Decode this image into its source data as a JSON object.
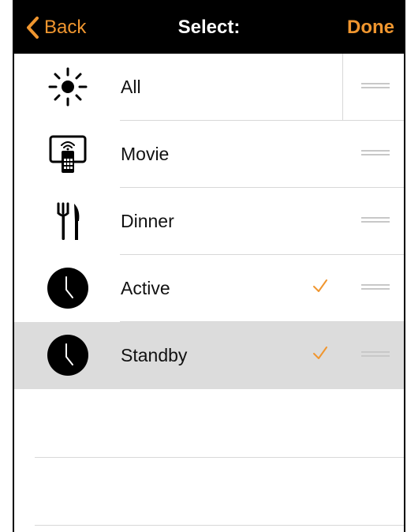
{
  "navbar": {
    "back_label": "Back",
    "title": "Select:",
    "done_label": "Done",
    "accent_color": "#f0962f"
  },
  "items": [
    {
      "label": "All",
      "icon": "sun-icon",
      "checked": false
    },
    {
      "label": "Movie",
      "icon": "tv-remote-icon",
      "checked": false
    },
    {
      "label": "Dinner",
      "icon": "fork-knife-icon",
      "checked": false
    },
    {
      "label": "Active",
      "icon": "clock-icon",
      "checked": true
    },
    {
      "label": "Standby",
      "icon": "clock-icon",
      "checked": true,
      "highlighted": true
    }
  ]
}
